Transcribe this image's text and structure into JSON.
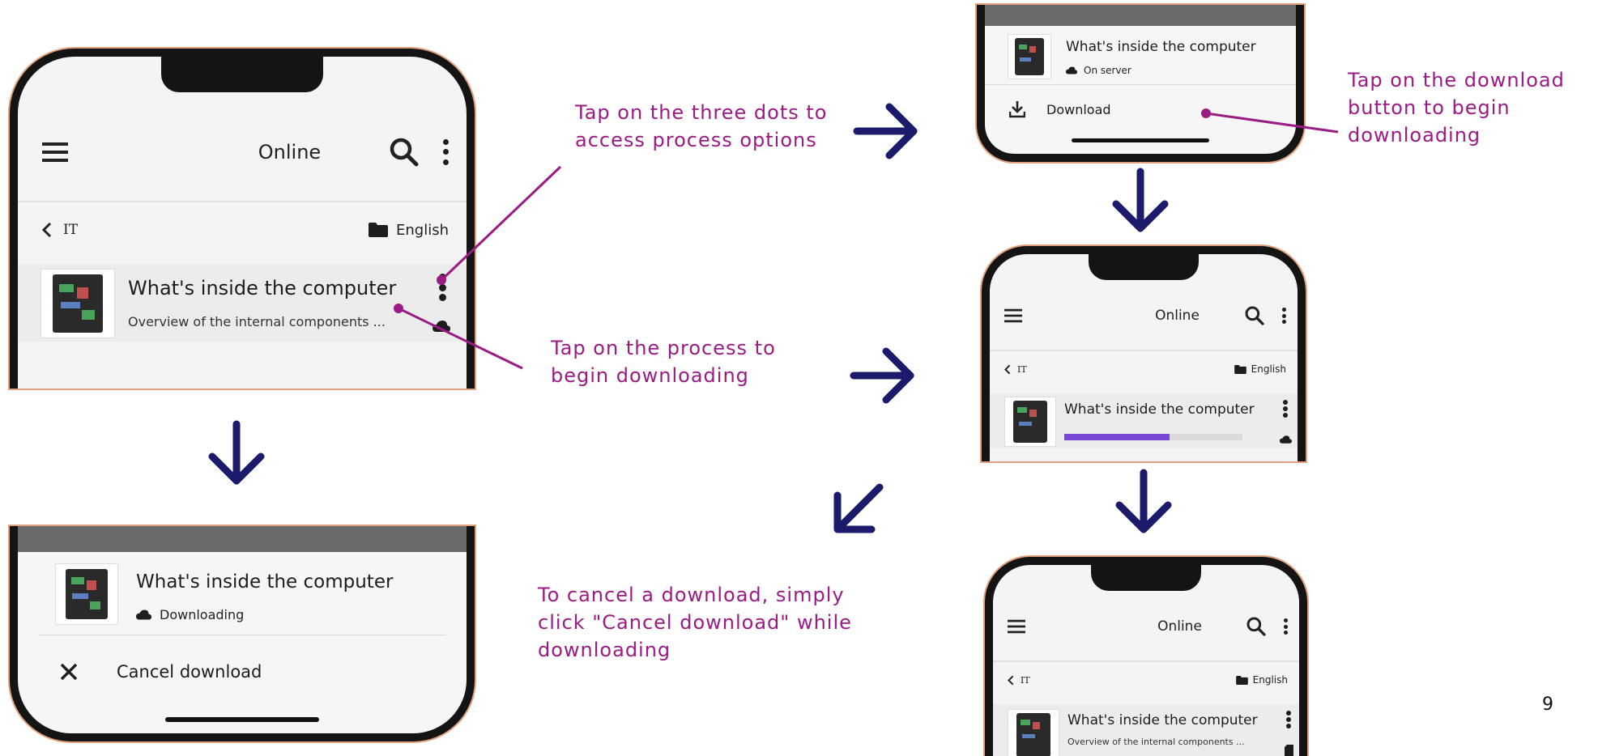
{
  "colors": {
    "callout": "#9b1b84",
    "arrow": "#1b1a6b",
    "progress": "#7748d3",
    "phone_frame": "#141414",
    "phone_edge": "#e0a27c"
  },
  "phone1": {
    "appbar_title": "Online",
    "breadcrumb_back": "IT",
    "breadcrumb_language": "English",
    "item_title": "What's inside the computer",
    "item_subtitle": "Overview of the internal components ..."
  },
  "phone2": {
    "item_title": "What's inside the computer",
    "item_status": "On server",
    "action_label": "Download"
  },
  "phone3": {
    "appbar_title": "Online",
    "breadcrumb_back": "IT",
    "breadcrumb_language": "English",
    "item_title": "What's inside the computer",
    "progress": 0.59
  },
  "phone4": {
    "appbar_title": "Online",
    "breadcrumb_back": "IT",
    "breadcrumb_language": "English",
    "item_title": "What's inside the computer",
    "item_subtitle": "Overview of the internal components ..."
  },
  "phone5": {
    "item_title": "What's inside the computer",
    "item_status": "Downloading",
    "action_label": "Cancel download"
  },
  "callouts": {
    "three_dots": "Tap on the three dots to access process options",
    "tap_process": "Tap on the process to begin downloading",
    "download_button": "Tap on the download button to begin downloading",
    "cancel": "To cancel a download, simply click \"Cancel download\" while downloading"
  },
  "page_number": "9"
}
